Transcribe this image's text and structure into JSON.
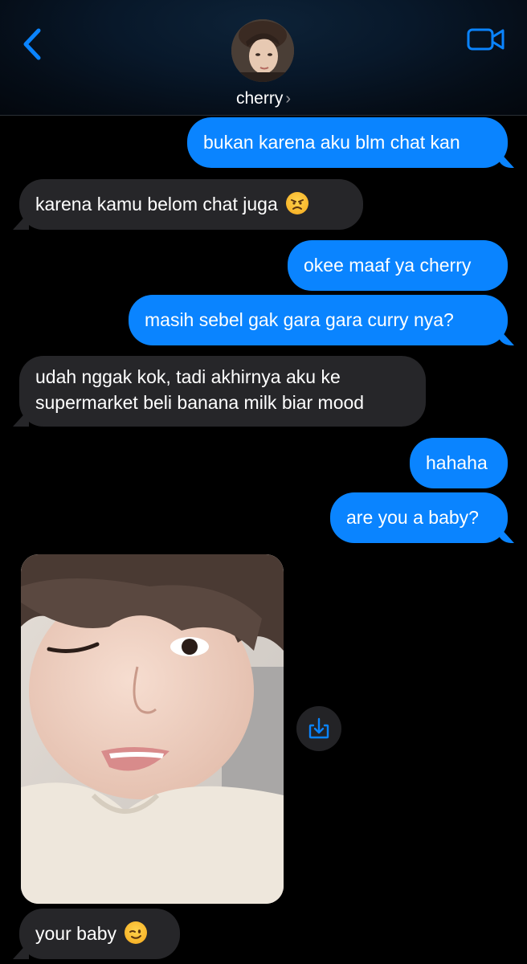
{
  "header": {
    "contact_name": "cherry",
    "contact_chevron": "›",
    "back_icon": "chevron-left-icon",
    "video_icon": "video-camera-icon",
    "accent": "#0a84ff"
  },
  "messages": [
    {
      "sender": "me",
      "text": "bukan karena aku blm chat kan"
    },
    {
      "sender": "cherry",
      "text": "karena kamu belom chat juga",
      "emoji": "angry-face"
    },
    {
      "sender": "me",
      "text": "okee maaf ya cherry"
    },
    {
      "sender": "me",
      "text": "masih sebel gak gara gara curry nya?"
    },
    {
      "sender": "cherry",
      "text": "udah nggak kok, tadi akhirnya aku ke supermarket beli banana milk biar mood"
    },
    {
      "sender": "me",
      "text": "hahaha"
    },
    {
      "sender": "me",
      "text": "are you a baby?"
    },
    {
      "sender": "cherry",
      "type": "photo",
      "save_icon": "save-download-icon"
    },
    {
      "sender": "cherry",
      "text": "your baby",
      "emoji": "winking-face"
    }
  ],
  "colors": {
    "sent_bubble": "#0a84ff",
    "received_bubble": "#262629",
    "background": "#000000"
  }
}
